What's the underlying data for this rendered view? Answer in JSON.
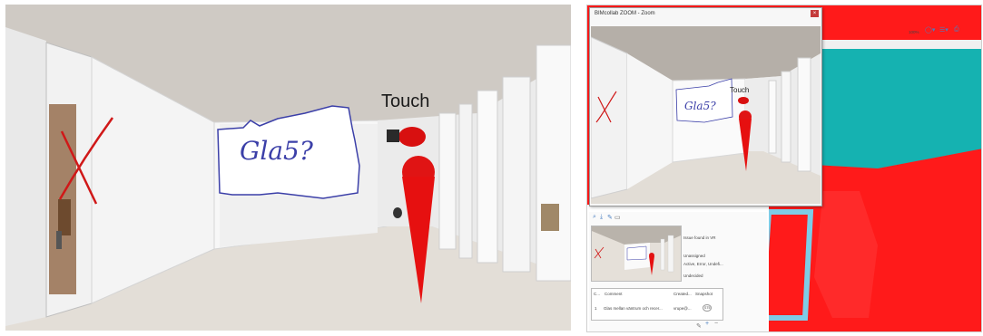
{
  "vr_view": {
    "touch_label": "Touch",
    "whiteboard_text": "Gla5?"
  },
  "desktop": {
    "zoom_window": {
      "title": "BIMcollab ZOOM - Zoom",
      "close_glyph": "×",
      "touch_label": "Touch",
      "whiteboard_text": "Gla5?"
    },
    "toolbar_right": {
      "zoom_level": "100%",
      "icons": [
        "circle-dropdown-icon",
        "layers-dropdown-icon",
        "print-icon"
      ]
    },
    "issue_panel": {
      "tool_icons": [
        "search-icon",
        "download-icon",
        "comment-icon",
        "delete-icon"
      ],
      "details": [
        "Issue found in VR",
        "Unassigned",
        "Active, Error, Undefi...",
        "Undecided"
      ],
      "comments_header": [
        "C...",
        "Comment",
        "Created...",
        "Snapshot"
      ],
      "comment_row": {
        "index": "1",
        "comment": "Glas mellan väntrum och recer...",
        "created": "vrupe@...",
        "snapshot_badge": "ST5"
      },
      "footer_icons": [
        "edit-icon",
        "add-icon",
        "remove-icon"
      ]
    },
    "colors": {
      "floor_red": "#ff1a1a",
      "wall_teal": "#15b2b1",
      "door_frame_blue": "#7ecce6"
    }
  }
}
